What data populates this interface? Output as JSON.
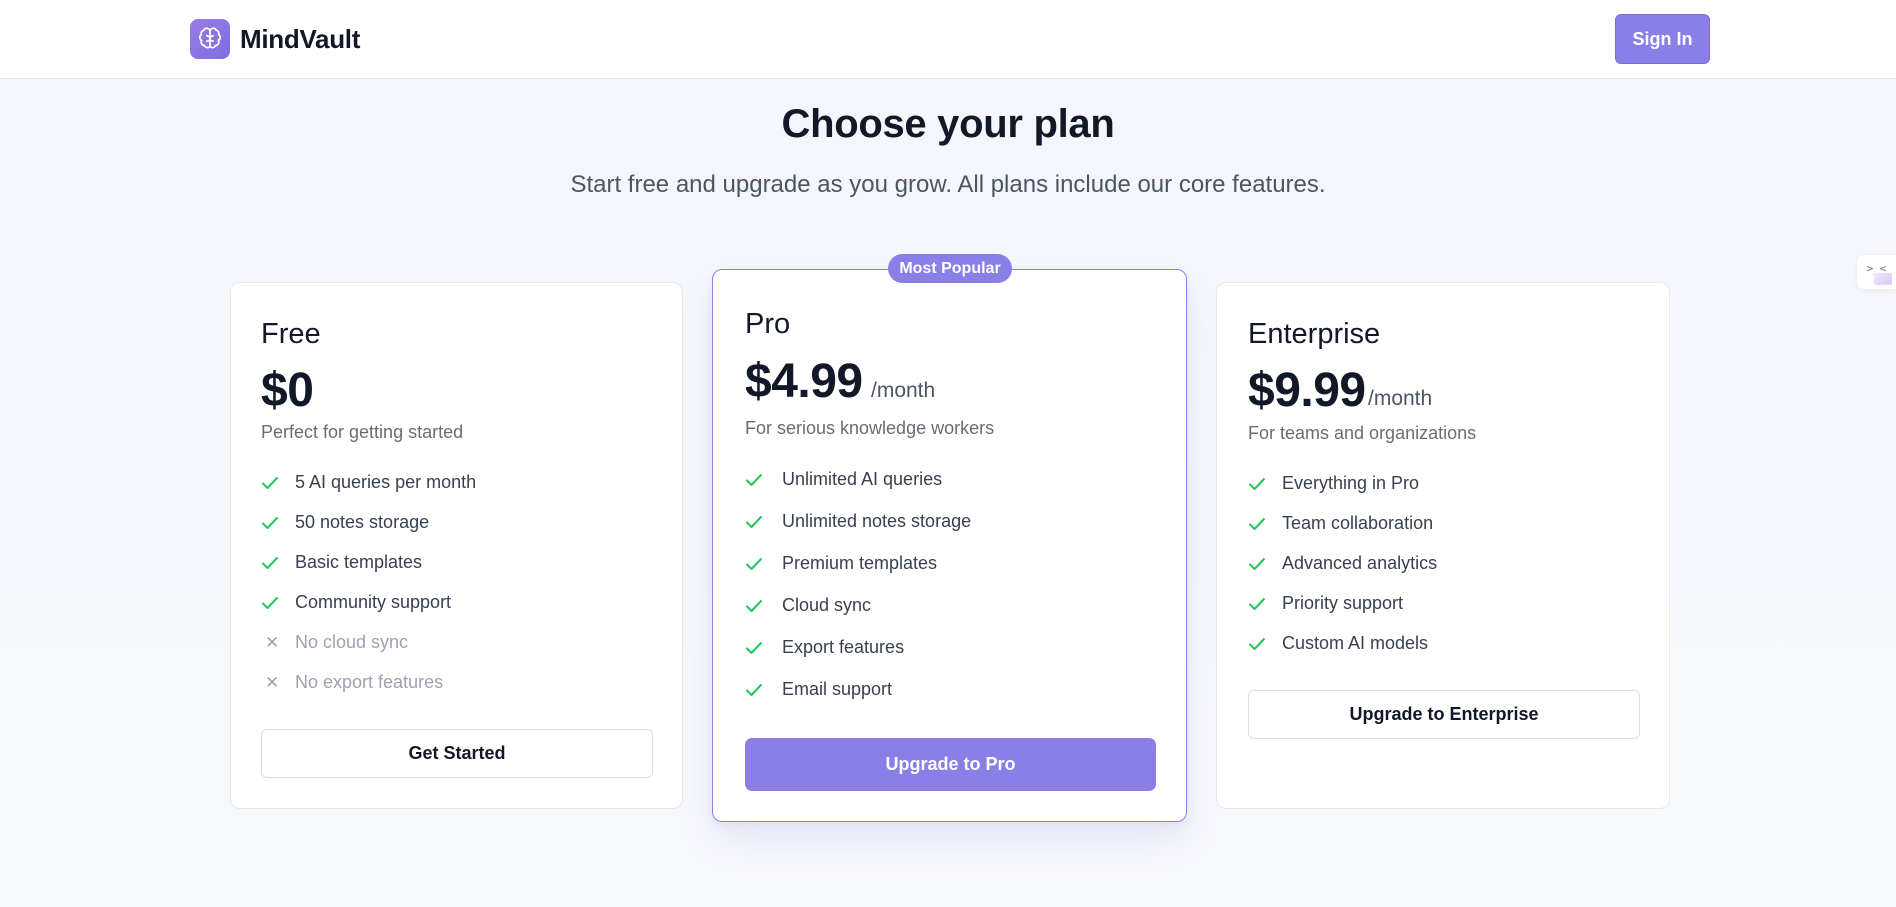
{
  "header": {
    "brand": "MindVault",
    "logo_icon": "brain-icon",
    "signin_label": "Sign In"
  },
  "hero": {
    "title": "Choose your plan",
    "subtitle": "Start free and upgrade as you grow. All plans include our core features."
  },
  "colors": {
    "accent": "#8a7fe6",
    "check": "#22c55e",
    "text": "#111827",
    "muted": "#6b6b78"
  },
  "plans": {
    "free": {
      "name": "Free",
      "price": "$0",
      "period": "",
      "description": "Perfect for getting started",
      "features": [
        {
          "text": "5 AI queries per month",
          "included": true
        },
        {
          "text": "50 notes storage",
          "included": true
        },
        {
          "text": "Basic templates",
          "included": true
        },
        {
          "text": "Community support",
          "included": true
        },
        {
          "text": "No cloud sync",
          "included": false
        },
        {
          "text": "No export features",
          "included": false
        }
      ],
      "cta": "Get Started"
    },
    "pro": {
      "badge": "Most Popular",
      "name": "Pro",
      "price": "$4.99",
      "period": "/month",
      "description": "For serious knowledge workers",
      "features": [
        {
          "text": "Unlimited AI queries",
          "included": true
        },
        {
          "text": "Unlimited notes storage",
          "included": true
        },
        {
          "text": "Premium templates",
          "included": true
        },
        {
          "text": "Cloud sync",
          "included": true
        },
        {
          "text": "Export features",
          "included": true
        },
        {
          "text": "Email support",
          "included": true
        }
      ],
      "cta": "Upgrade to Pro"
    },
    "enterprise": {
      "name": "Enterprise",
      "price": "$9.99",
      "period": "/month",
      "description": "For teams and organizations",
      "features": [
        {
          "text": "Everything in Pro",
          "included": true
        },
        {
          "text": "Team collaboration",
          "included": true
        },
        {
          "text": "Advanced analytics",
          "included": true
        },
        {
          "text": "Priority support",
          "included": true
        },
        {
          "text": "Custom AI models",
          "included": true
        }
      ],
      "cta": "Upgrade to Enterprise"
    }
  },
  "side_tab": {
    "glyph": ">_<",
    "icon": "terminal-icon"
  }
}
